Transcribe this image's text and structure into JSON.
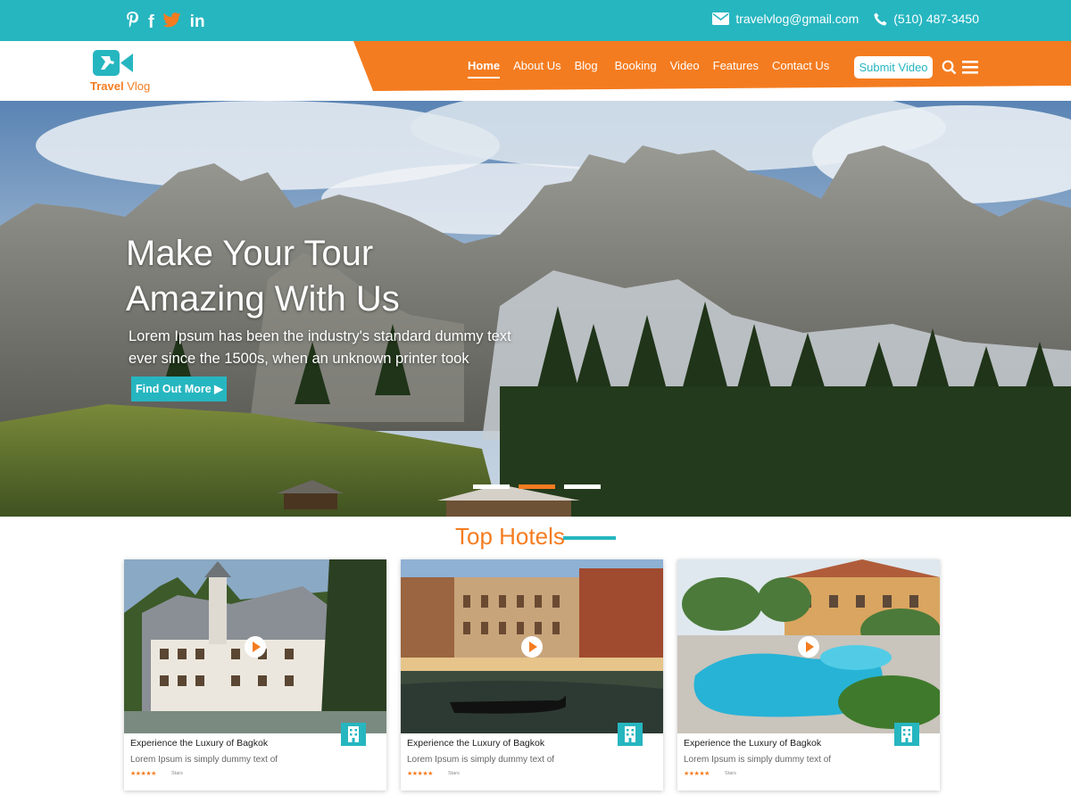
{
  "topbar": {
    "social": [
      {
        "name": "pinterest",
        "glyph": "℗"
      },
      {
        "name": "facebook",
        "glyph": "f"
      },
      {
        "name": "twitter",
        "glyph": "t"
      },
      {
        "name": "linkedin",
        "glyph": "in"
      }
    ],
    "email": "travelvlog@gmail.com",
    "phone": "(510) 487-3450"
  },
  "brand": {
    "name_part1": "Travel",
    "name_part2": " Vlog"
  },
  "nav": {
    "items": [
      "Home",
      "About Us",
      "Blog",
      "Booking",
      "Video",
      "Features",
      "Contact Us"
    ],
    "active": "Home",
    "submit_label": "Submit Video"
  },
  "hero": {
    "title": "Make Your Tour Amazing With Us",
    "subtitle": "Lorem Ipsum has been the industry's standard dummy text ever since the 1500s, when an unknown printer took",
    "button_label": "Find Out More ▶",
    "slides": 3,
    "active_slide": 2
  },
  "section": {
    "title": "Top Hotels"
  },
  "hotels": [
    {
      "title": "Experience the Luxury of Bagkok",
      "description": "Lorem Ipsum is simply dummy text of",
      "stars": "★★★★★",
      "rating_label": "Stars"
    },
    {
      "title": "Experience the Luxury of Bagkok",
      "description": "Lorem Ipsum is simply dummy text of",
      "stars": "★★★★★",
      "rating_label": "Stars"
    },
    {
      "title": "Experience the Luxury of Bagkok",
      "description": "Lorem Ipsum is simply dummy text of",
      "stars": "★★★★★",
      "rating_label": "Stars"
    }
  ],
  "colors": {
    "teal": "#26b6c0",
    "orange": "#f47c20"
  }
}
